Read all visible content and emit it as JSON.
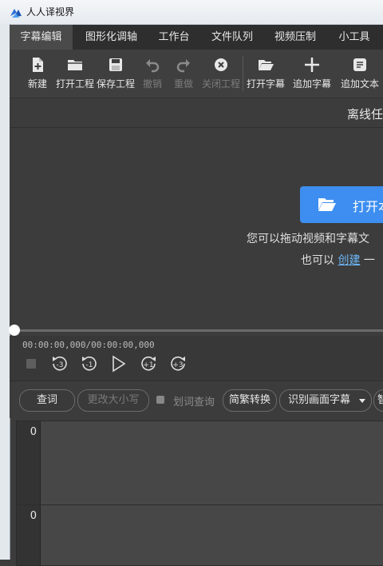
{
  "app": {
    "title": "人人译视界"
  },
  "menu": [
    {
      "label": "字幕编辑",
      "active": true
    },
    {
      "label": "图形化调轴"
    },
    {
      "label": "工作台"
    },
    {
      "label": "文件队列"
    },
    {
      "label": "视频压制"
    },
    {
      "label": "小工具"
    }
  ],
  "toolbar": [
    {
      "label": "新建",
      "icon": "new-file-icon",
      "enabled": true
    },
    {
      "label": "打开工程",
      "icon": "folder-icon",
      "enabled": true
    },
    {
      "label": "保存工程",
      "icon": "save-icon",
      "enabled": true
    },
    {
      "label": "撤销",
      "icon": "undo-icon",
      "enabled": false
    },
    {
      "label": "重做",
      "icon": "redo-icon",
      "enabled": false
    },
    {
      "label": "关闭工程",
      "icon": "close-circle-icon",
      "enabled": false
    },
    {
      "label": "打开字幕",
      "icon": "open-folder-icon",
      "enabled": true
    },
    {
      "label": "追加字幕",
      "icon": "plus-icon",
      "enabled": true
    },
    {
      "label": "追加文本",
      "icon": "text-doc-icon",
      "enabled": true
    }
  ],
  "status": {
    "text": "离线任"
  },
  "video": {
    "open_label": "打开本",
    "drag_hint": "您可以拖动视频和字幕文",
    "alt_prefix": "也可以 ",
    "alt_link": "创建",
    "alt_suffix": " 一"
  },
  "player": {
    "timecode": "00:00:00,000/00:00:00,000",
    "progress": 0,
    "controls": [
      {
        "name": "stop",
        "icon": "stop-icon"
      },
      {
        "name": "back-3",
        "icon": "rewind-3s-icon",
        "text": "-3"
      },
      {
        "name": "back-1",
        "icon": "rewind-1s-icon",
        "text": "-1"
      },
      {
        "name": "play",
        "icon": "play-icon"
      },
      {
        "name": "fwd-1",
        "icon": "forward-1s-icon",
        "text": "+1"
      },
      {
        "name": "fwd-3",
        "icon": "forward-3s-icon",
        "text": "+3"
      }
    ]
  },
  "editor": {
    "lookup_label": "查词",
    "case_label": "更改大小写",
    "select_lookup_label": "划词查询",
    "convert_label": "简繁转换",
    "ocr_label": "识别画面字幕",
    "more_label": "智"
  },
  "rows": [
    {
      "index": "0"
    },
    {
      "index": "0"
    }
  ],
  "colors": {
    "accent": "#3d8ef0",
    "link": "#6cb6f5",
    "panel": "#3c3c3c",
    "menubar": "#2e2e2e"
  }
}
